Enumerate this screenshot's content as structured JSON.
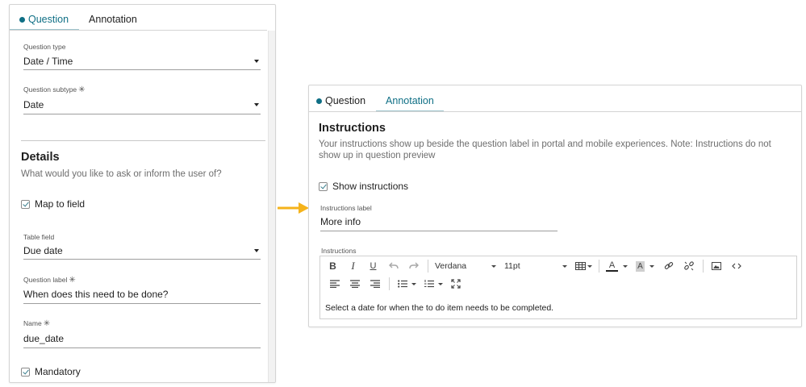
{
  "left_panel": {
    "tabs": [
      {
        "label": "Question",
        "active": true
      },
      {
        "label": "Annotation",
        "active": false
      }
    ],
    "question_type": {
      "label": "Question type",
      "value": "Date / Time"
    },
    "question_subtype": {
      "label": "Question subtype",
      "required_mark": "✳",
      "value": "Date"
    },
    "details": {
      "title": "Details",
      "description": "What would you like to ask or inform the user of?"
    },
    "map_to_field": {
      "label": "Map to field",
      "checked": true
    },
    "table_field": {
      "label": "Table field",
      "value": "Due date"
    },
    "question_label": {
      "label": "Question label",
      "required_mark": "✳",
      "value": "When does this need to be done?"
    },
    "name": {
      "label": "Name",
      "required_mark": "✳",
      "value": "due_date"
    },
    "mandatory": {
      "label": "Mandatory",
      "checked": true
    }
  },
  "arrow": {
    "color": "#f5b31b",
    "icon": "arrow-right-icon"
  },
  "right_panel": {
    "tabs": [
      {
        "label": "Question",
        "active": false
      },
      {
        "label": "Annotation",
        "active": true
      }
    ],
    "instructions": {
      "title": "Instructions",
      "description_line1": "Your instructions show up beside the question label in portal and mobile experiences. Note: Instructions do not",
      "description_line2": "show up in question preview"
    },
    "show_instructions": {
      "label": "Show instructions",
      "checked": true
    },
    "instructions_label": {
      "label": "Instructions label",
      "value": "More info"
    },
    "instructions_editor": {
      "label": "Instructions",
      "toolbar": {
        "bold": "B",
        "italic": "I",
        "underline": "U",
        "font_family": "Verdana",
        "font_size": "11pt",
        "font_color": "A",
        "highlight": "A"
      },
      "content": "Select a date for when the to do item needs to be completed."
    }
  },
  "colors": {
    "accent": "#0f6f85",
    "arrow": "#f5b31b",
    "tab_underline": "#9fc4cd"
  }
}
